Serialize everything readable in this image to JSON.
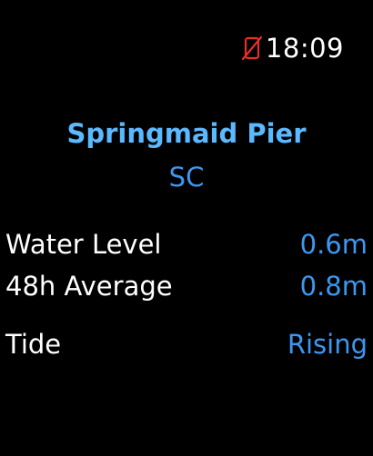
{
  "status": {
    "time": "18:09",
    "icon": "phone-disconnected-icon",
    "icon_color": "#e5302a"
  },
  "station": {
    "name": "Springmaid Pier",
    "state": "SC"
  },
  "readings": {
    "water_level": {
      "label": "Water Level",
      "value": "0.6m"
    },
    "average": {
      "label": "48h Average",
      "value": "0.8m"
    },
    "tide": {
      "label": "Tide",
      "value": "Rising"
    }
  },
  "colors": {
    "title": "#5ab9ff",
    "value": "#3d97f0",
    "background": "#000000"
  }
}
